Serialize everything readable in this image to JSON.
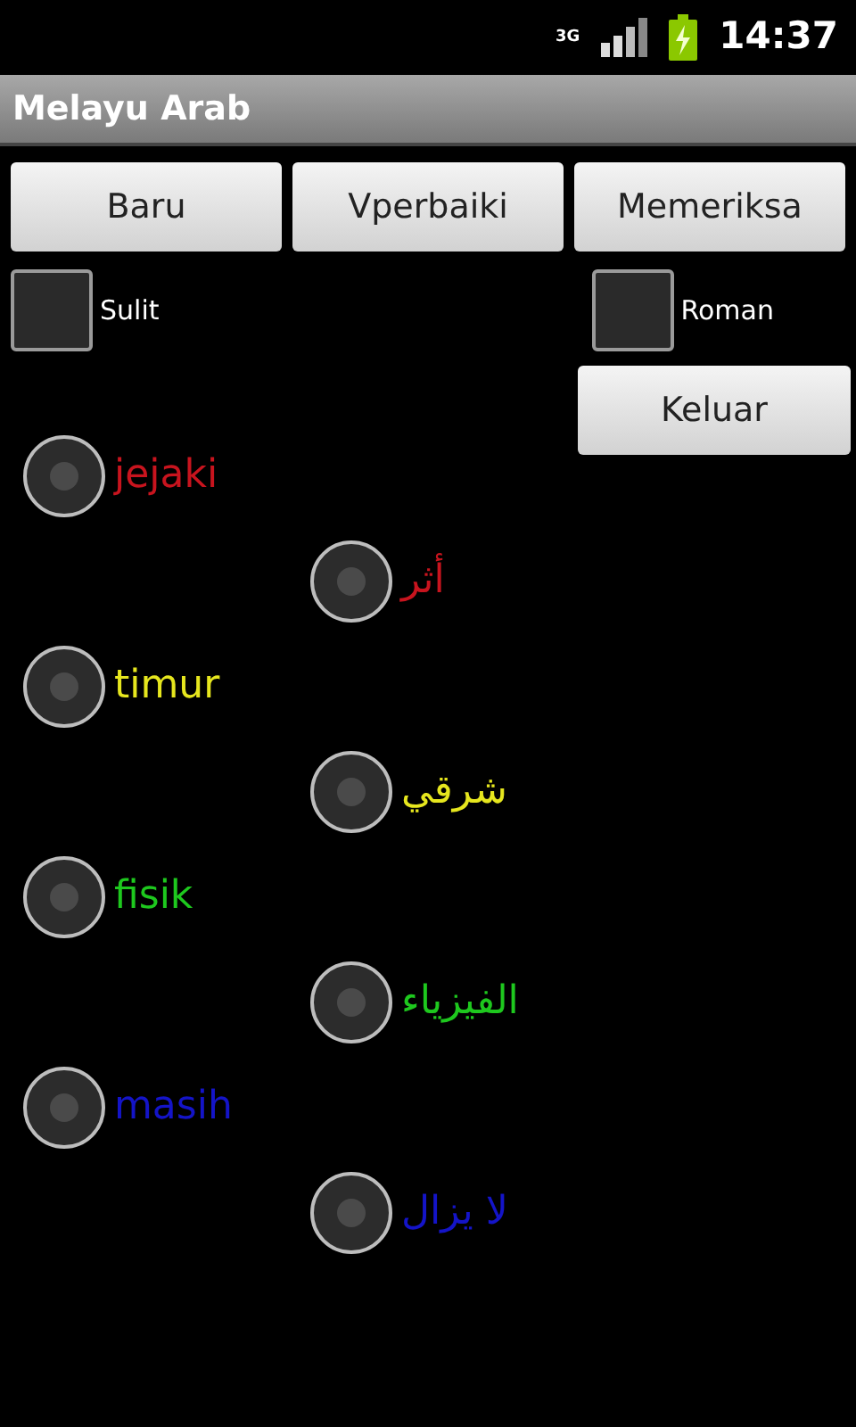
{
  "status_bar": {
    "time": "14:37",
    "network": "3G"
  },
  "title": "Melayu Arab",
  "buttons": [
    "Baru",
    "Vperbaiki",
    "Memeriksa"
  ],
  "checkboxes": [
    {
      "label": "Sulit",
      "checked": false
    },
    {
      "label": "Roman",
      "checked": false
    }
  ],
  "exit_button": "Keluar",
  "options": [
    {
      "kind": "latin",
      "text": "jejaki",
      "color": "#c8141e",
      "selected": false
    },
    {
      "kind": "arabic",
      "text": "أثر",
      "color": "#c8141e",
      "selected": false
    },
    {
      "kind": "latin",
      "text": "timur",
      "color": "#e6e61e",
      "selected": false
    },
    {
      "kind": "arabic",
      "text": "شرقي",
      "color": "#e6e61e",
      "selected": false
    },
    {
      "kind": "latin",
      "text": "fisik",
      "color": "#1ec81e",
      "selected": false
    },
    {
      "kind": "arabic",
      "text": "الفيزياء",
      "color": "#1ec81e",
      "selected": false
    },
    {
      "kind": "latin",
      "text": "masih",
      "color": "#1414c8",
      "selected": false
    },
    {
      "kind": "arabic",
      "text": "لا يزال",
      "color": "#1414c8",
      "selected": false
    }
  ]
}
